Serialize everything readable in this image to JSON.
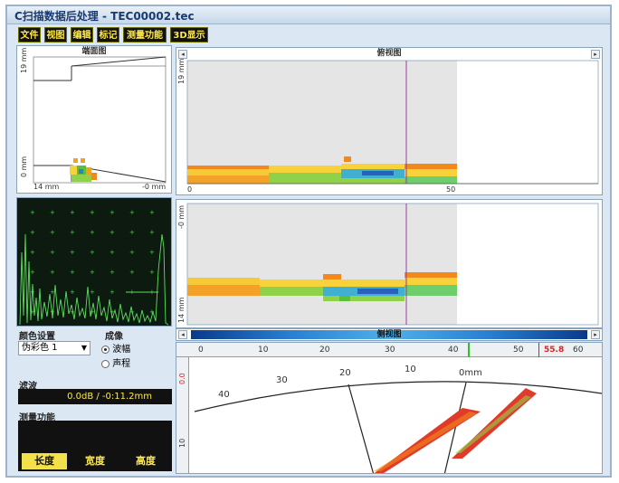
{
  "window": {
    "title": "C扫描数据后处理 - TEC00002.tec"
  },
  "menu": [
    "文件",
    "视图",
    "编辑",
    "标记",
    "测量功能",
    "3D显示"
  ],
  "end_view": {
    "title": "端面图",
    "y_top_label": "19 mm",
    "y_bottom_label": "0 mm",
    "x_left_label": "14 mm",
    "x_right_label": "-0 mm"
  },
  "front_view": {
    "title": "俯视图",
    "y_label": "19 mm",
    "x_ticks": [
      "0",
      "50"
    ]
  },
  "mid_view": {
    "y_top_label": "-0 mm",
    "y_bottom_label": "14 mm"
  },
  "side_view": {
    "title": "侧视图"
  },
  "color_settings": {
    "label": "颜色设置",
    "selected": "伪彩色 1"
  },
  "imaging": {
    "label": "成像",
    "options": [
      "波幅",
      "声程"
    ],
    "selected": "波幅"
  },
  "gate": {
    "label": "滤波",
    "value": "0.0dB / -0:11.2mm"
  },
  "measure": {
    "label": "测量功能",
    "buttons": [
      "长度",
      "宽度",
      "高度"
    ],
    "active": "长度"
  },
  "ruler": {
    "ticks": [
      "0",
      "10",
      "20",
      "30",
      "40",
      "50",
      "60"
    ],
    "marker_value": "55.8",
    "left_top": "0.0",
    "left_mid": "10"
  },
  "sector": {
    "arc_labels": [
      "40",
      "30",
      "20",
      "10",
      "0mm"
    ]
  },
  "colors": {
    "accent": "#ffe94a",
    "cursor": "#9b3c9b",
    "marker": "#e02020"
  }
}
